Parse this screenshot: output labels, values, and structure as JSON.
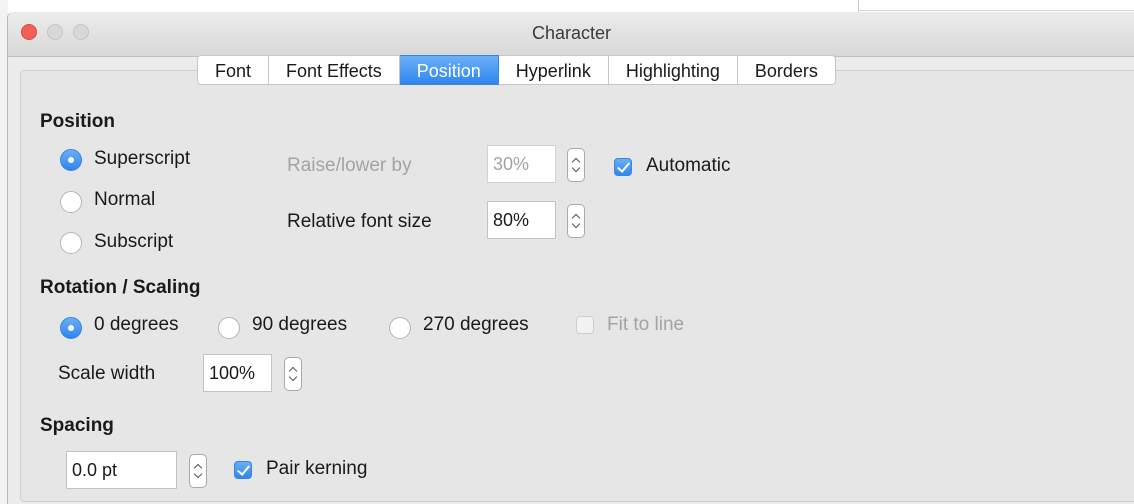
{
  "window": {
    "title": "Character"
  },
  "tabs": [
    "Font",
    "Font Effects",
    "Position",
    "Hyperlink",
    "Highlighting",
    "Borders"
  ],
  "active_tab": "Position",
  "position": {
    "heading": "Position",
    "superscript": "Superscript",
    "normal": "Normal",
    "subscript": "Subscript",
    "selected": "Superscript",
    "raise_lower_label": "Raise/lower by",
    "raise_lower_value": "30%",
    "automatic_label": "Automatic",
    "automatic_checked": true,
    "relative_font_size_label": "Relative font size",
    "relative_font_size_value": "80%"
  },
  "rotation": {
    "heading": "Rotation / Scaling",
    "deg0": "0 degrees",
    "deg90": "90 degrees",
    "deg270": "270 degrees",
    "selected": "0 degrees",
    "fit_to_line": "Fit to line",
    "fit_to_line_checked": false,
    "scale_width_label": "Scale width",
    "scale_width_value": "100%"
  },
  "spacing": {
    "heading": "Spacing",
    "value": "0.0 pt",
    "pair_kerning_label": "Pair kerning",
    "pair_kerning_checked": true
  },
  "colors": {
    "accent": "#2f86ee",
    "close": "#f25f57",
    "disabled_text": "#a3a3a3"
  }
}
